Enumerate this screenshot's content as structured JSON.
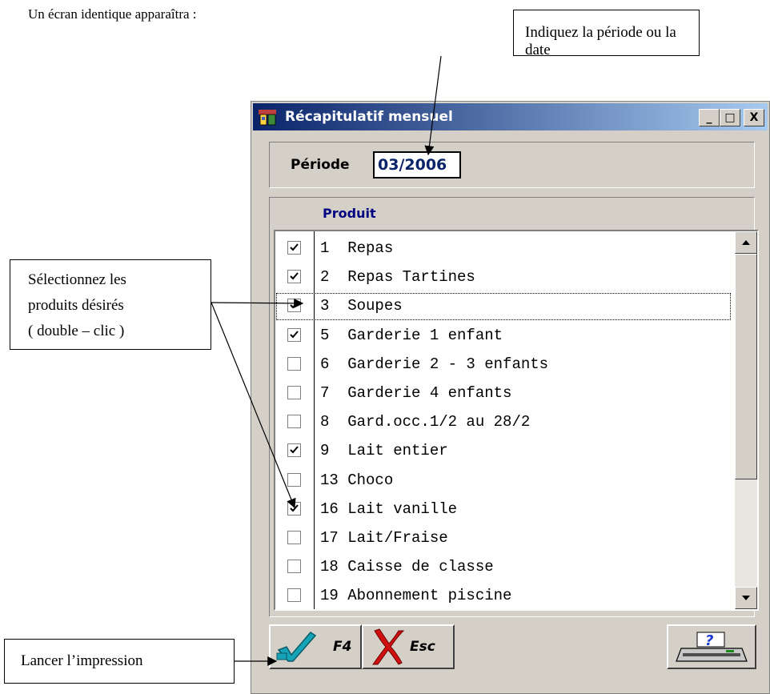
{
  "document": {
    "intro_text": "Un écran identique apparaîtra :"
  },
  "callouts": {
    "period": "Indiquez la période ou la date",
    "select_line1": "Sélectionnez les",
    "select_line2": "produits désirés",
    "select_line3": "( double – clic )",
    "print": "Lancer l’impression"
  },
  "window": {
    "title": "Récapitulatif mensuel",
    "minimize_glyph": "_",
    "maximize_glyph": "□",
    "close_glyph": "X"
  },
  "periode": {
    "label": "Période",
    "value": "03/2006"
  },
  "list": {
    "header": "Produit",
    "items": [
      {
        "text": "1  Repas",
        "checked": true
      },
      {
        "text": "2  Repas Tartines",
        "checked": true
      },
      {
        "text": "3  Soupes",
        "checked": true,
        "focused": true
      },
      {
        "text": "5  Garderie 1 enfant",
        "checked": true
      },
      {
        "text": "6  Garderie 2 - 3 enfants",
        "checked": false
      },
      {
        "text": "7  Garderie 4 enfants",
        "checked": false
      },
      {
        "text": "8  Gard.occ.1/2 au 28/2",
        "checked": false
      },
      {
        "text": "9  Lait entier",
        "checked": true
      },
      {
        "text": "13 Choco",
        "checked": false
      },
      {
        "text": "16 Lait vanille",
        "checked": true
      },
      {
        "text": "17 Lait/Fraise",
        "checked": false
      },
      {
        "text": "18 Caisse de classe",
        "checked": false
      },
      {
        "text": "19 Abonnement piscine",
        "checked": false
      }
    ]
  },
  "buttons": {
    "ok_label": "F4",
    "esc_label": "Esc"
  },
  "icons": {
    "app": "app-icon",
    "ok": "checkmark-icon",
    "esc": "red-x-icon",
    "print": "printer-help-icon"
  },
  "colors": {
    "title_bar_start": "#0a246a",
    "title_bar_end": "#a6caf0",
    "window_face": "#d4d0c8",
    "periode_text": "#0a246a",
    "header_text": "#000080",
    "ok_icon": "#16a3b8",
    "esc_icon": "#d01010"
  }
}
